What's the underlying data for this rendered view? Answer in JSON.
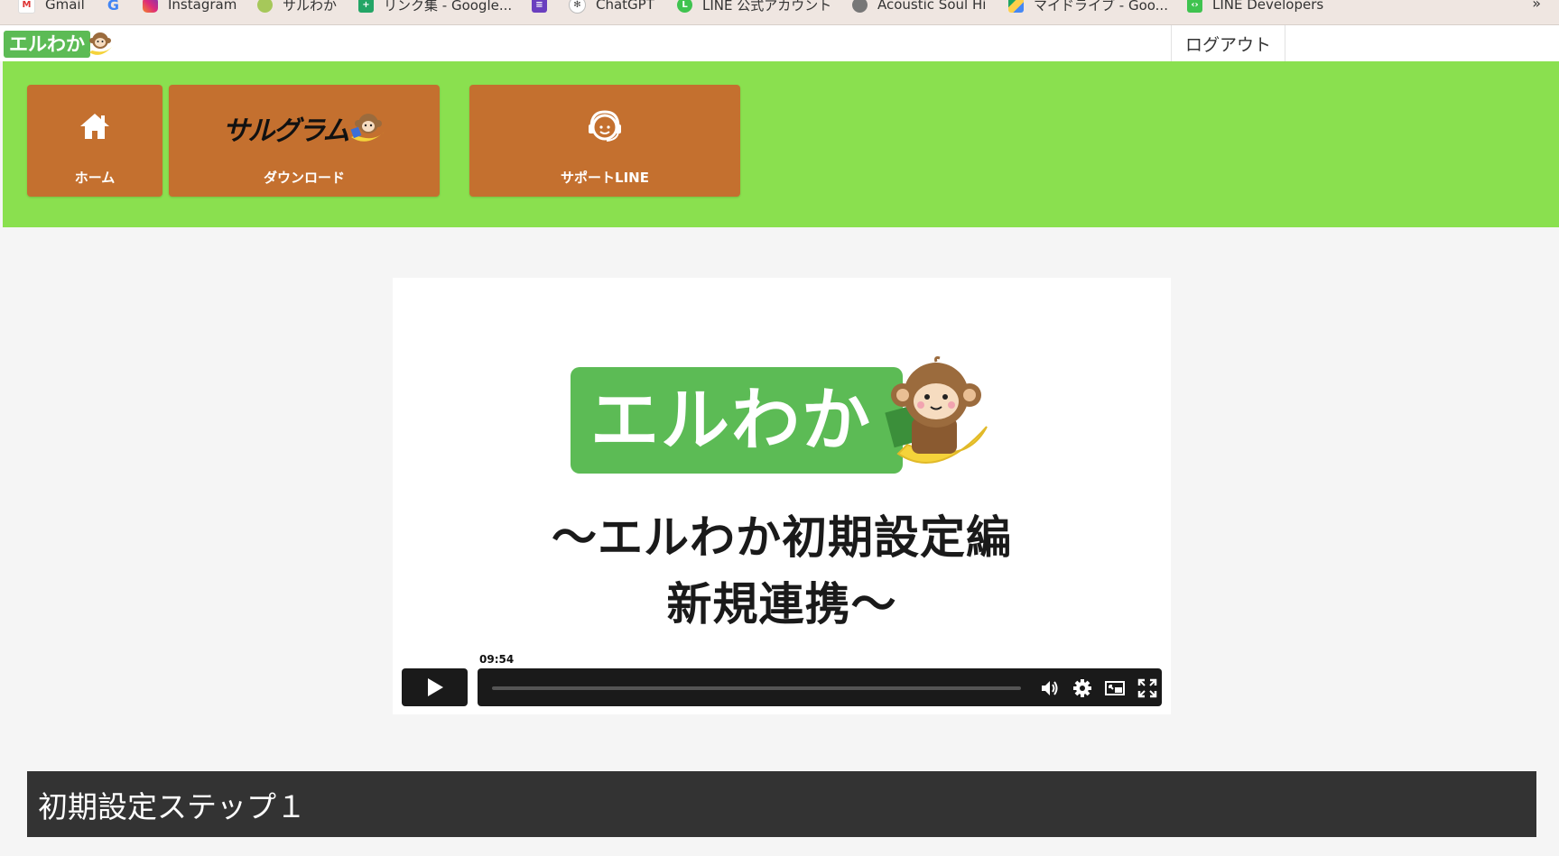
{
  "bookmarks": {
    "items": [
      {
        "label": "Gmail",
        "icon": "gmail-icon"
      },
      {
        "label": "",
        "icon": "google-icon"
      },
      {
        "label": "Instagram",
        "icon": "instagram-icon"
      },
      {
        "label": "サルわか",
        "icon": "saruwaka-icon"
      },
      {
        "label": "リンク集 - Google...",
        "icon": "google-sheets-icon"
      },
      {
        "label": "",
        "icon": "google-forms-icon"
      },
      {
        "label": "ChatGPT",
        "icon": "chatgpt-icon"
      },
      {
        "label": "LINE 公式アカウント",
        "icon": "line-icon"
      },
      {
        "label": "Acoustic Soul Hi",
        "icon": "acoustic-soul-icon"
      },
      {
        "label": "マイドライブ - Goo...",
        "icon": "google-drive-icon"
      },
      {
        "label": "LINE Developers",
        "icon": "line-developers-icon"
      }
    ],
    "more": "»"
  },
  "header": {
    "logo_text": "エルわか",
    "logout_label": "ログアウト"
  },
  "nav": {
    "home_label": "ホーム",
    "download_logo_text": "サルグラム",
    "download_label": "ダウンロード",
    "support_label": "サポートLINE"
  },
  "video": {
    "logo_text": "エルわか",
    "title_line1": "〜エルわか初期設定編",
    "title_line2": "新規連携〜",
    "duration": "09:54",
    "progress": 0
  },
  "step": {
    "title": "初期設定ステップ１"
  },
  "colors": {
    "nav_green": "#8ae04f",
    "nav_button": "#c4702f",
    "logo_green": "#5cbb55",
    "step_bar": "#333333"
  }
}
